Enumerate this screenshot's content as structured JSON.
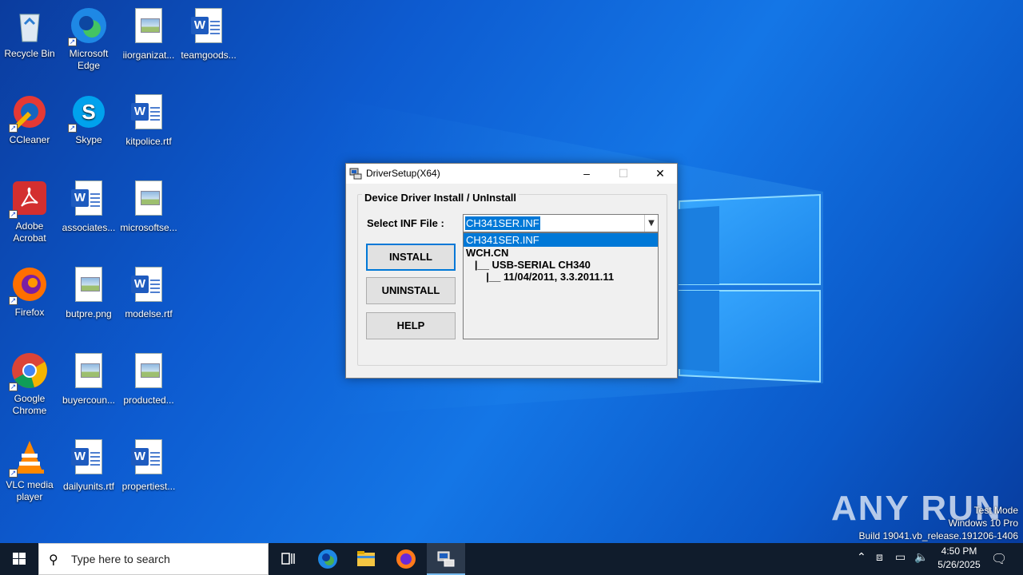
{
  "desktop": {
    "icons": [
      {
        "label": "Recycle Bin",
        "icon": "recycle-bin-icon"
      },
      {
        "label": "Microsoft Edge",
        "icon": "edge-icon"
      },
      {
        "label": "iiorganizat...",
        "icon": "image-file-icon"
      },
      {
        "label": "teamgoods...",
        "icon": "word-file-icon"
      },
      {
        "label": "CCleaner",
        "icon": "ccleaner-icon"
      },
      {
        "label": "Skype",
        "icon": "skype-icon"
      },
      {
        "label": "kitpolice.rtf",
        "icon": "word-file-icon"
      },
      {
        "label": "Adobe Acrobat",
        "icon": "acrobat-icon"
      },
      {
        "label": "associates...",
        "icon": "word-file-icon"
      },
      {
        "label": "microsoftse...",
        "icon": "image-file-icon"
      },
      {
        "label": "Firefox",
        "icon": "firefox-icon"
      },
      {
        "label": "butpre.png",
        "icon": "image-file-icon"
      },
      {
        "label": "modelse.rtf",
        "icon": "word-file-icon"
      },
      {
        "label": "Google Chrome",
        "icon": "chrome-icon"
      },
      {
        "label": "buyercoun...",
        "icon": "image-file-icon"
      },
      {
        "label": "producted...",
        "icon": "image-file-icon"
      },
      {
        "label": "VLC media player",
        "icon": "vlc-icon"
      },
      {
        "label": "dailyunits.rtf",
        "icon": "word-file-icon"
      },
      {
        "label": "propertiest...",
        "icon": "word-file-icon"
      }
    ]
  },
  "window": {
    "title": "DriverSetup(X64)",
    "minimize": "–",
    "maximize": "☐",
    "close": "✕",
    "group_label": "Device Driver Install / UnInstall",
    "inf_label": "Select INF File :",
    "combo_value": "CH341SER.INF",
    "dropdown": {
      "selected": "CH341SER.INF",
      "lines": [
        "WCH.CN",
        "   |__ USB-SERIAL CH340",
        "       |__ 11/04/2011, 3.3.2011.11"
      ]
    },
    "buttons": {
      "install": "INSTALL",
      "uninstall": "UNINSTALL",
      "help": "HELP"
    }
  },
  "taskbar": {
    "search_placeholder": "Type here to search",
    "time": "4:50 PM",
    "date": "5/26/2025"
  },
  "watermark": {
    "brand": "ANY RUN",
    "line1": "Test Mode",
    "line2": "Windows 10 Pro",
    "line3": "Build 19041.vb_release.191206-1406"
  }
}
